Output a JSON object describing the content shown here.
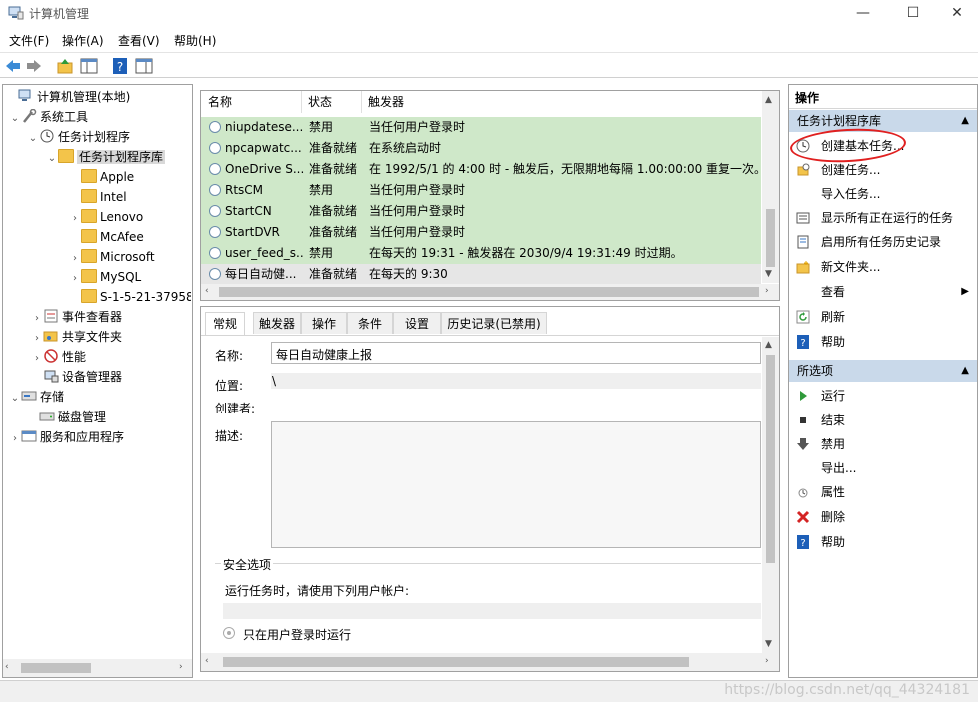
{
  "window": {
    "title": "计算机管理",
    "minimize": "—",
    "maximize": "☐",
    "close": "✕"
  },
  "menu": [
    "文件(F)",
    "操作(A)",
    "查看(V)",
    "帮助(H)"
  ],
  "tree": {
    "root": "计算机管理(本地)",
    "system_tools": "系统工具",
    "task_scheduler": "任务计划程序",
    "task_library": "任务计划程序库",
    "folders": [
      "Apple",
      "Intel",
      "Lenovo",
      "McAfee",
      "Microsoft",
      "MySQL",
      "S-1-5-21-37958"
    ],
    "event_viewer": "事件查看器",
    "shared_folders": "共享文件夹",
    "performance": "性能",
    "device_manager": "设备管理器",
    "storage": "存储",
    "disk_management": "磁盘管理",
    "services_apps": "服务和应用程序"
  },
  "tasklist": {
    "columns": [
      "名称",
      "状态",
      "触发器"
    ],
    "rows": [
      {
        "name": "niupdatese...",
        "status": "禁用",
        "trigger": "当任何用户登录时"
      },
      {
        "name": "npcapwatc...",
        "status": "准备就绪",
        "trigger": "在系统启动时"
      },
      {
        "name": "OneDrive S...",
        "status": "准备就绪",
        "trigger": "在 1992/5/1 的 4:00 时 - 触发后，无限期地每隔 1.00:00:00 重复一次。"
      },
      {
        "name": "RtsCM",
        "status": "禁用",
        "trigger": "当任何用户登录时"
      },
      {
        "name": "StartCN",
        "status": "准备就绪",
        "trigger": "当任何用户登录时"
      },
      {
        "name": "StartDVR",
        "status": "准备就绪",
        "trigger": "当任何用户登录时"
      },
      {
        "name": "user_feed_s...",
        "status": "禁用",
        "trigger": "在每天的 19:31 - 触发器在 2030/9/4 19:31:49 时过期。"
      },
      {
        "name": "每日自动健...",
        "status": "准备就绪",
        "trigger": "在每天的 9:30"
      }
    ]
  },
  "detail": {
    "tabs": [
      "常规",
      "触发器",
      "操作",
      "条件",
      "设置",
      "历史记录(已禁用)"
    ],
    "name_label": "名称:",
    "name_value": "每日自动健康上报",
    "location_label": "位置:",
    "location_value": "\\",
    "author_label": "创建者:",
    "desc_label": "描述:",
    "security_label": "安全选项",
    "run_as_label": "运行任务时，请使用下列用户帐户:",
    "radio_label": "只在用户登录时运行"
  },
  "actions": {
    "header": "操作",
    "section1": "任务计划程序库",
    "items1": [
      "创建基本任务...",
      "创建任务...",
      "导入任务...",
      "显示所有正在运行的任务",
      "启用所有任务历史记录",
      "新文件夹...",
      "查看",
      "刷新",
      "帮助"
    ],
    "section2": "所选项",
    "items2": [
      "运行",
      "结束",
      "禁用",
      "导出...",
      "属性",
      "删除",
      "帮助"
    ]
  },
  "watermark": "https://blog.csdn.net/qq_44324181",
  "colors": {
    "row_green": "#cfe8c9",
    "section_blue": "#c9d9ea",
    "annotation_red": "#e02020"
  }
}
